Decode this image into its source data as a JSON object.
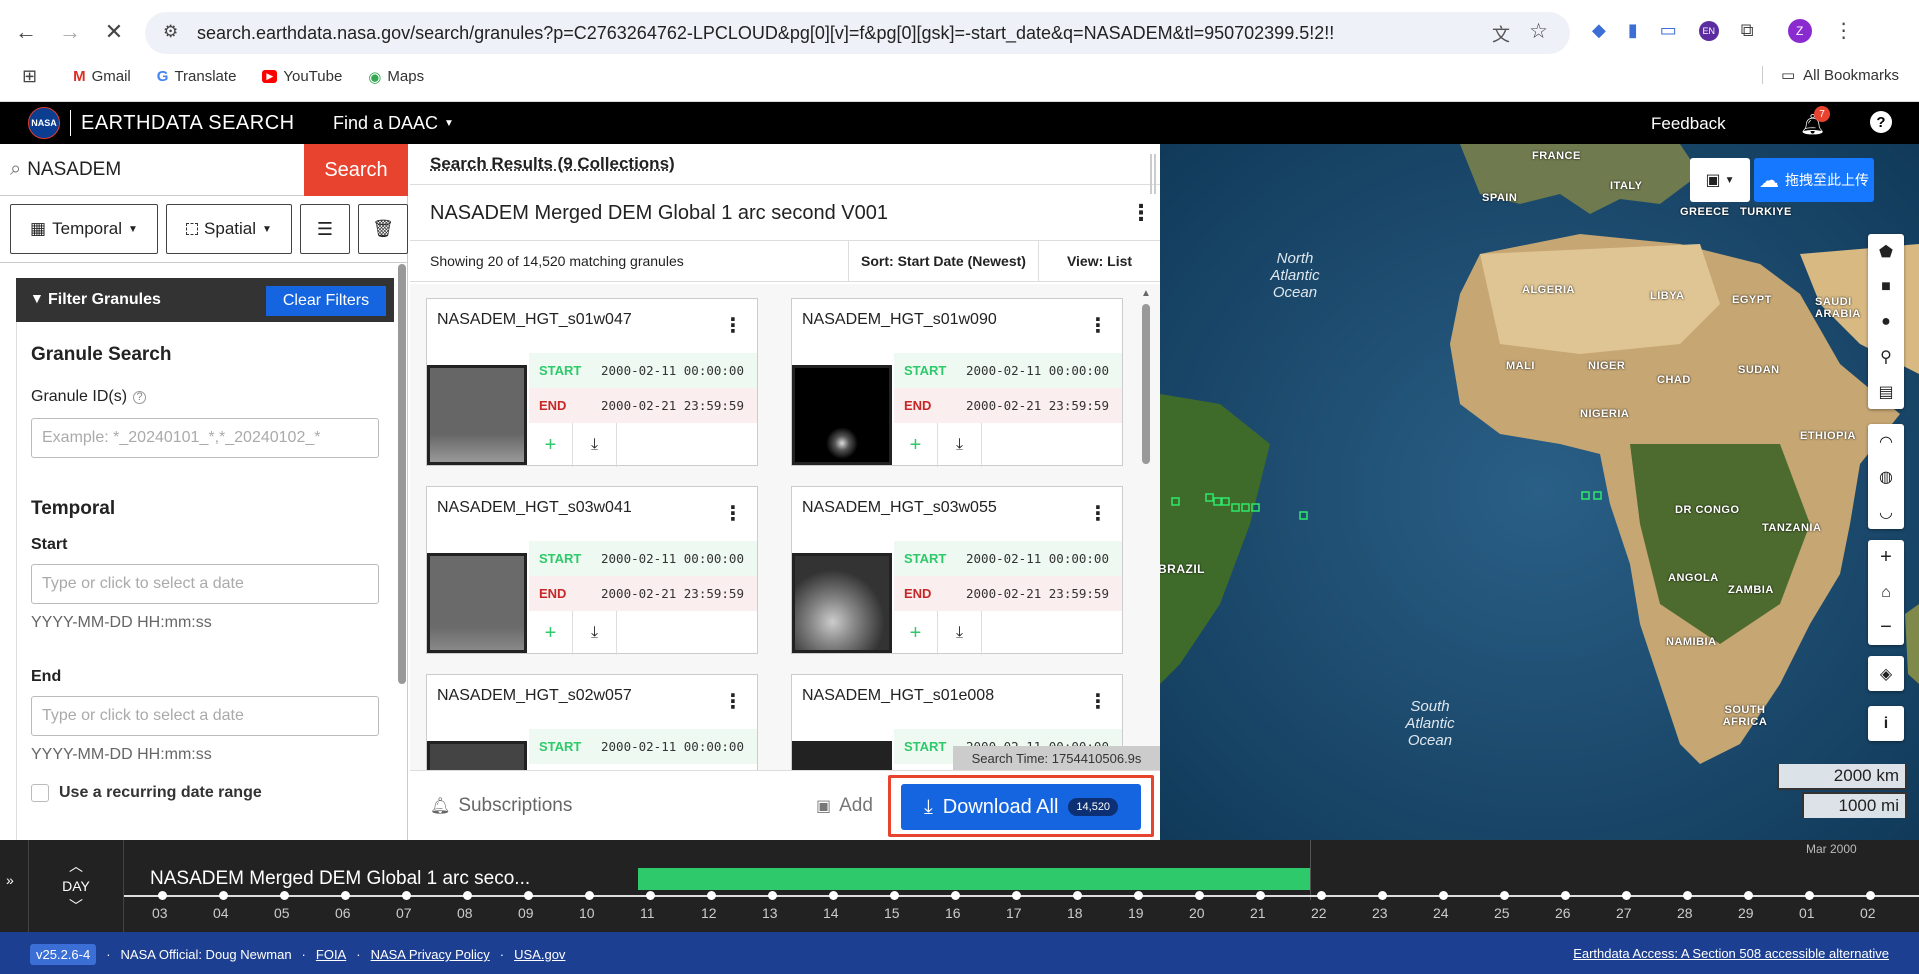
{
  "browser": {
    "url": "search.earthdata.nasa.gov/search/granules?p=C2763264762-LPCLOUD&pg[0][v]=f&pg[0][gsk]=-start_date&q=NASADEM&tl=950702399.5!2!!",
    "bookmarks": [
      "Gmail",
      "Translate",
      "YouTube",
      "Maps"
    ],
    "all_bookmarks": "All Bookmarks",
    "profile_letter": "Z",
    "ext_badge": "EN"
  },
  "header": {
    "app_title": "EARTHDATA SEARCH",
    "find_daac": "Find a DAAC",
    "feedback": "Feedback",
    "notif_count": "7",
    "help": "?"
  },
  "search": {
    "query": "NASADEM",
    "button": "Search"
  },
  "filters": {
    "temporal": "Temporal",
    "spatial": "Spatial",
    "panel_title": "Filter Granules",
    "clear": "Clear Filters",
    "granule_search": "Granule Search",
    "granule_ids_label": "Granule ID(s)",
    "granule_ids_placeholder": "Example: *_20240101_*,*_20240102_*",
    "temporal_heading": "Temporal",
    "start_label": "Start",
    "start_placeholder": "Type or click to select a date",
    "start_hint": "YYYY-MM-DD HH:mm:ss",
    "end_label": "End",
    "end_placeholder": "Type or click to select a date",
    "end_hint": "YYYY-MM-DD HH:mm:ss",
    "recurring": "Use a recurring date range"
  },
  "results": {
    "breadcrumb": "Search Results (9 Collections)",
    "collection_title": "NASADEM Merged DEM Global 1 arc second V001",
    "showing": "Showing 20 of 14,520 matching granules",
    "sort": "Sort: Start Date (Newest)",
    "view": "View: List",
    "start_key": "START",
    "end_key": "END",
    "granules": [
      {
        "name": "NASADEM_HGT_s01w047",
        "start": "2000-02-11 00:00:00",
        "end": "2000-02-21 23:59:59"
      },
      {
        "name": "NASADEM_HGT_s01w090",
        "start": "2000-02-11 00:00:00",
        "end": "2000-02-21 23:59:59"
      },
      {
        "name": "NASADEM_HGT_s03w041",
        "start": "2000-02-11 00:00:00",
        "end": "2000-02-21 23:59:59"
      },
      {
        "name": "NASADEM_HGT_s03w055",
        "start": "2000-02-11 00:00:00",
        "end": "2000-02-21 23:59:59"
      },
      {
        "name": "NASADEM_HGT_s02w057",
        "start": "2000-02-11 00:00:00",
        "end": ""
      },
      {
        "name": "NASADEM_HGT_s01e008",
        "start": "2000-02-11 00:00:00",
        "end": ""
      }
    ],
    "search_time": "Search Time: 1754410506.9s",
    "subscriptions": "Subscriptions",
    "add": "Add",
    "download_all": "Download All",
    "download_count": "14,520"
  },
  "map": {
    "upload_label": "拖拽至此上传",
    "countries": [
      "FRANCE",
      "SPAIN",
      "ITALY",
      "GREECE",
      "TURKIYE",
      "ALGERIA",
      "LIBYA",
      "EGYPT",
      "SAUDI ARABIA",
      "MALI",
      "NIGER",
      "CHAD",
      "SUDAN",
      "NIGERIA",
      "ETHIOPIA",
      "DR CONGO",
      "TANZANIA",
      "ANGOLA",
      "ZAMBIA",
      "NAMIBIA",
      "SOUTH AFRICA",
      "BRAZIL"
    ],
    "oceans": [
      "North Atlantic Ocean",
      "South Atlantic Ocean"
    ],
    "scale_km": "2000 km",
    "scale_mi": "1000 mi"
  },
  "timeline": {
    "zoom_unit": "DAY",
    "collection": "NASADEM Merged DEM Global 1 arc seco...",
    "month_label": "Mar 2000",
    "ticks": [
      "03",
      "04",
      "05",
      "06",
      "07",
      "08",
      "09",
      "10",
      "11",
      "12",
      "13",
      "14",
      "15",
      "16",
      "17",
      "18",
      "19",
      "20",
      "21",
      "22",
      "23",
      "24",
      "25",
      "26",
      "27",
      "28",
      "29",
      "01",
      "02"
    ]
  },
  "footer": {
    "version": "v25.2.6-4",
    "official": "NASA Official: Doug Newman",
    "foia": "FOIA",
    "privacy": "NASA Privacy Policy",
    "usa": "USA.gov",
    "accessible": "Earthdata Access: A Section 508 accessible alternative"
  },
  "colors": {
    "accent_red": "#e8432f",
    "download_blue": "#1565e0",
    "green": "#2ec96a",
    "footer_blue": "#1d3f91"
  }
}
